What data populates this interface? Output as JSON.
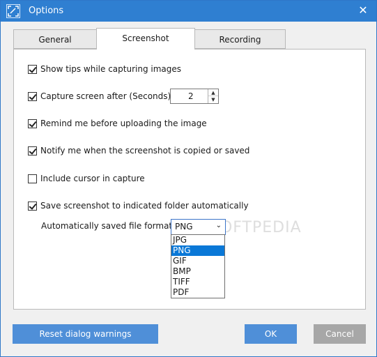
{
  "window": {
    "title": "Options",
    "close_icon": "close-icon"
  },
  "tabs": [
    {
      "label": "General",
      "active": false
    },
    {
      "label": "Screenshot",
      "active": true
    },
    {
      "label": "Recording",
      "active": false
    }
  ],
  "options": [
    {
      "label": "Show tips while capturing images",
      "checked": true
    },
    {
      "label": "Capture screen after (Seconds):",
      "checked": true
    },
    {
      "label": "Remind me before uploading the image",
      "checked": true
    },
    {
      "label": "Notify me when the screenshot is copied or saved",
      "checked": true
    },
    {
      "label": "Include cursor in capture",
      "checked": false
    },
    {
      "label": "Save screenshot to indicated folder automatically",
      "checked": true
    }
  ],
  "delay_spinner": {
    "value": "2"
  },
  "format": {
    "label": "Automatically saved file format:",
    "selected": "PNG",
    "options": [
      "JPG",
      "PNG",
      "GIF",
      "BMP",
      "TIFF",
      "PDF"
    ],
    "highlighted_index": 1
  },
  "watermark": "SOFTPEDIA",
  "buttons": {
    "reset": "Reset dialog warnings",
    "ok": "OK",
    "cancel": "Cancel"
  },
  "colors": {
    "titlebar": "#2f7fd1",
    "button": "#4f8fd8",
    "cancel_button": "#a7a7a7",
    "selection": "#0a78d7"
  }
}
